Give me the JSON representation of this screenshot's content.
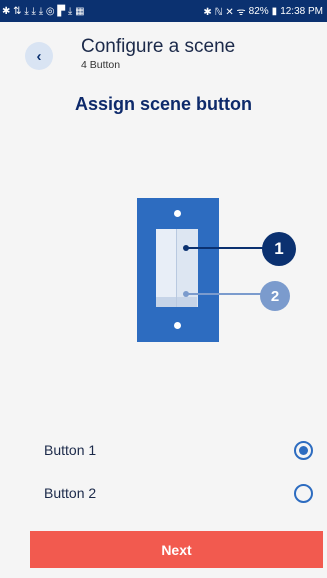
{
  "status_bar": {
    "left_icons": "✱ ⇅ ⤓ ⤓ ⤓ ◎ ▛ ⤓ ▦",
    "right_icons": "✱ ℕ ✕ ᯤ",
    "battery": "82%",
    "time": "12:38 PM"
  },
  "header": {
    "back_icon": "chevron-left-icon",
    "title": "Configure a scene",
    "subtitle": "4 Button"
  },
  "heading": "Assign scene button",
  "device": {
    "marker_1": "1",
    "marker_2": "2",
    "colors": {
      "body": "#2d6cc0",
      "marker_1": "#0b3170",
      "marker_2": "#7b9bcd"
    }
  },
  "options": [
    {
      "label": "Button 1",
      "selected": true
    },
    {
      "label": "Button 2",
      "selected": false
    }
  ],
  "next_label": "Next",
  "colors": {
    "accent": "#2d6cc0",
    "primary_button": "#f25a4f",
    "status_bar": "#0b3170"
  }
}
